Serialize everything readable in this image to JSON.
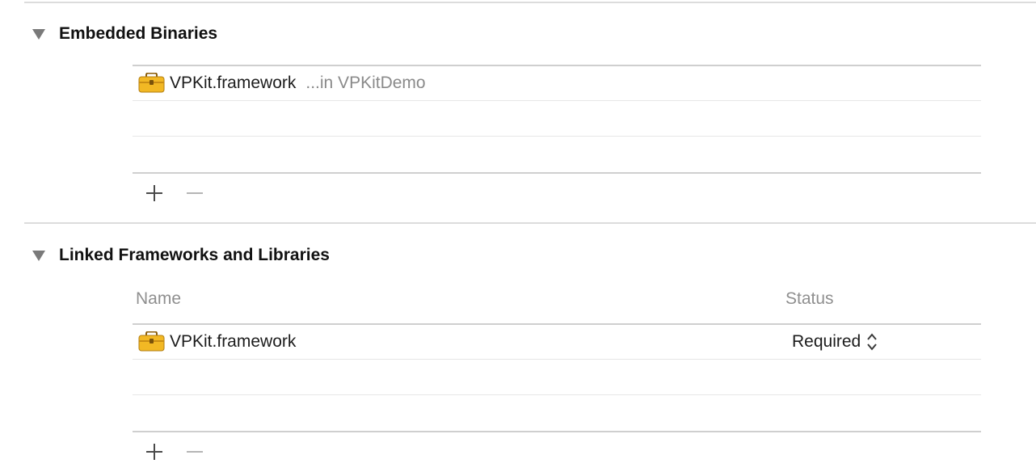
{
  "embedded_binaries": {
    "title": "Embedded Binaries",
    "items": [
      {
        "name": "VPKit.framework",
        "location": "...in VPKitDemo",
        "icon": "framework-toolbox-icon"
      }
    ],
    "add_icon": "plus-icon",
    "remove_icon": "minus-icon"
  },
  "linked_frameworks": {
    "title": "Linked Frameworks and Libraries",
    "columns": {
      "name": "Name",
      "status": "Status"
    },
    "items": [
      {
        "name": "VPKit.framework",
        "status": "Required",
        "icon": "framework-toolbox-icon"
      }
    ],
    "add_icon": "plus-icon",
    "remove_icon": "minus-icon"
  },
  "colors": {
    "icon_yellow": "#f2b824",
    "icon_dark": "#b27e12",
    "secondary_text": "#8a8a8a",
    "divider": "#dcdcdc"
  }
}
